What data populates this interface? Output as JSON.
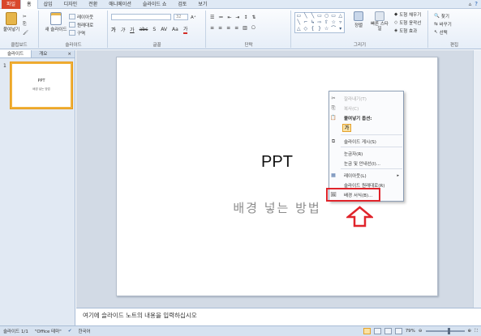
{
  "ribbon_tabs": {
    "file": "파일",
    "items": [
      "홈",
      "삽입",
      "디자인",
      "전환",
      "애니메이션",
      "슬라이드 쇼",
      "검토",
      "보기"
    ],
    "active_index": 0
  },
  "ribbon": {
    "clipboard": {
      "paste": "붙여넣기",
      "label": "클립보드"
    },
    "slides": {
      "new_slide": "새 슬라이드",
      "layout": "레이아웃",
      "reset": "원래대로",
      "section": "구역",
      "label": "슬라이드"
    },
    "font": {
      "label": "글꼴",
      "size": "32"
    },
    "paragraph": {
      "label": "단락"
    },
    "drawing": {
      "arrange": "정렬",
      "quick_styles": "빠른 스타일",
      "label": "그리기",
      "shape_fill": "도형 채우기",
      "shape_outline": "도형 윤곽선",
      "shape_effects": "도형 효과"
    },
    "editing": {
      "find": "찾기",
      "replace": "바꾸기",
      "select": "선택",
      "label": "편집"
    }
  },
  "side_pane": {
    "tab_slides": "슬라이드",
    "tab_outline": "개요",
    "close": "×",
    "thumb_number": "1",
    "thumb_title": "PPT",
    "thumb_subtitle": "배경 넣는 방법"
  },
  "slide": {
    "title": "PPT",
    "subtitle": "배경 넣는 방법"
  },
  "context_menu": {
    "items": [
      {
        "label": "잘라내기(T)",
        "icon": "✂",
        "disabled": true
      },
      {
        "label": "복사(C)",
        "icon": "⎘",
        "disabled": true
      },
      {
        "label": "붙여넣기 옵션:",
        "icon": "📋",
        "disabled": false
      },
      {
        "label": "슬라이드 게시(S)",
        "icon": "⧉",
        "disabled": false
      },
      {
        "label": "눈금자(R)",
        "icon": "",
        "disabled": false
      },
      {
        "label": "눈금 및 안내선(I)...",
        "icon": "",
        "disabled": false
      },
      {
        "label": "레이아웃(L)",
        "icon": "▦",
        "disabled": false
      },
      {
        "label": "슬라이드 원래대로(R)",
        "icon": "",
        "disabled": false
      },
      {
        "label": "배경 서식(B)...",
        "icon": "🖼",
        "disabled": false
      }
    ],
    "paste_option": "가",
    "submenu_arrow": "▸"
  },
  "notes": {
    "placeholder": "여기에 슬라이드 노트의 내용을 입력하십시오"
  },
  "status_bar": {
    "slide_count": "슬라이드 1/1",
    "theme": "\"Office 테마\"",
    "language": "한국어",
    "zoom": "79%"
  },
  "colors": {
    "file_tab": "#d9472b",
    "highlight": "#e0242b",
    "thumb_border": "#f0b13a"
  }
}
